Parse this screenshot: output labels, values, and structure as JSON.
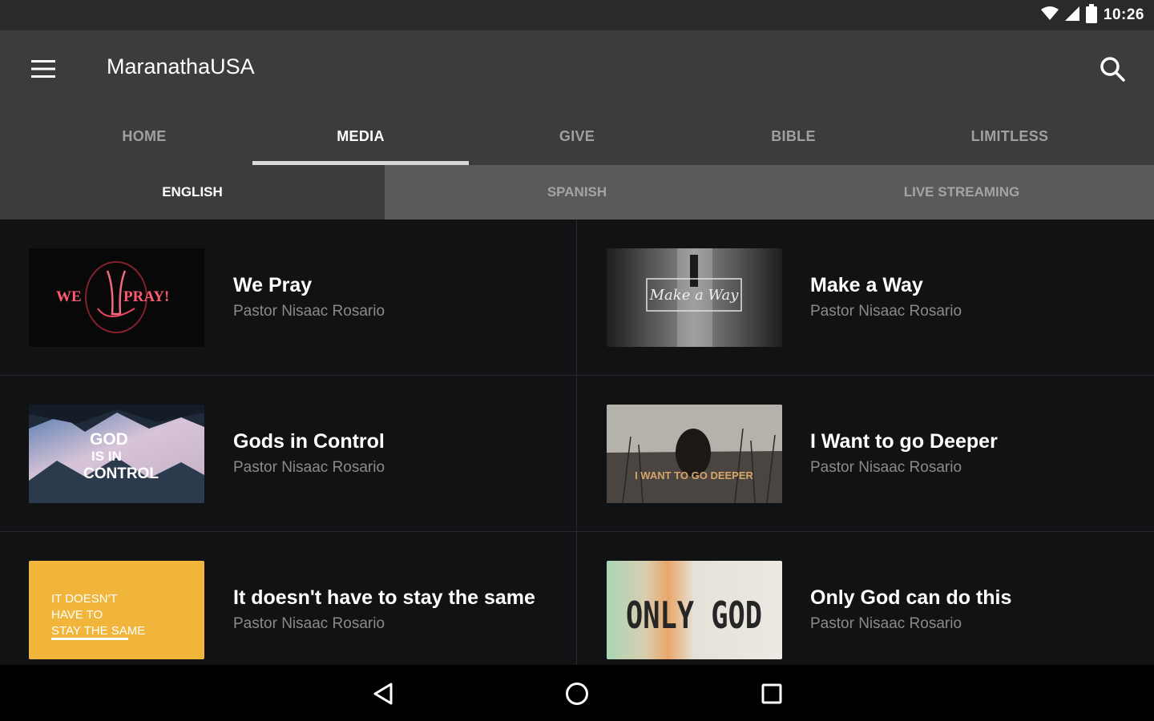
{
  "status": {
    "time": "10:26",
    "icons": [
      "wifi-icon",
      "signal-icon",
      "battery-icon"
    ]
  },
  "app": {
    "title": "MaranathaUSA",
    "menu_icon": "hamburger-menu-icon",
    "search_icon": "search-icon"
  },
  "tabs": [
    {
      "label": "HOME",
      "active": false
    },
    {
      "label": "MEDIA",
      "active": true
    },
    {
      "label": "GIVE",
      "active": false
    },
    {
      "label": "BIBLE",
      "active": false
    },
    {
      "label": "LIMITLESS",
      "active": false
    }
  ],
  "subtabs": [
    {
      "label": "ENGLISH",
      "active": true
    },
    {
      "label": "SPANISH",
      "active": false
    },
    {
      "label": "LIVE STREAMING",
      "active": false
    }
  ],
  "items": [
    {
      "title": "We Pray",
      "subtitle": "Pastor Nisaac Rosario",
      "thumb_text": [
        "WE",
        "PRAY!"
      ]
    },
    {
      "title": "Make a Way",
      "subtitle": "Pastor Nisaac Rosario",
      "thumb_text": [
        "Make a Way"
      ]
    },
    {
      "title": "Gods in Control",
      "subtitle": "Pastor Nisaac Rosario",
      "thumb_text": [
        "GOD",
        "IS IN",
        "CONTROL"
      ]
    },
    {
      "title": "I Want to go Deeper",
      "subtitle": "Pastor Nisaac Rosario",
      "thumb_text": [
        "I WANT TO GO DEEPER"
      ]
    },
    {
      "title": "It doesn't have to stay the same",
      "subtitle": "Pastor Nisaac Rosario",
      "thumb_text": [
        "IT DOESN'T",
        "HAVE TO",
        "STAY THE SAME"
      ]
    },
    {
      "title": "Only God can do this",
      "subtitle": "Pastor Nisaac Rosario",
      "thumb_text": [
        "ONLY GOD"
      ]
    }
  ],
  "navbar": {
    "icons": [
      "back-icon",
      "home-icon",
      "recents-icon"
    ]
  },
  "colors": {
    "appbar": "#3c3c3c",
    "statusbar": "#2a2a2a",
    "background": "#111214",
    "subtab_inactive": "#5a5a5a"
  }
}
